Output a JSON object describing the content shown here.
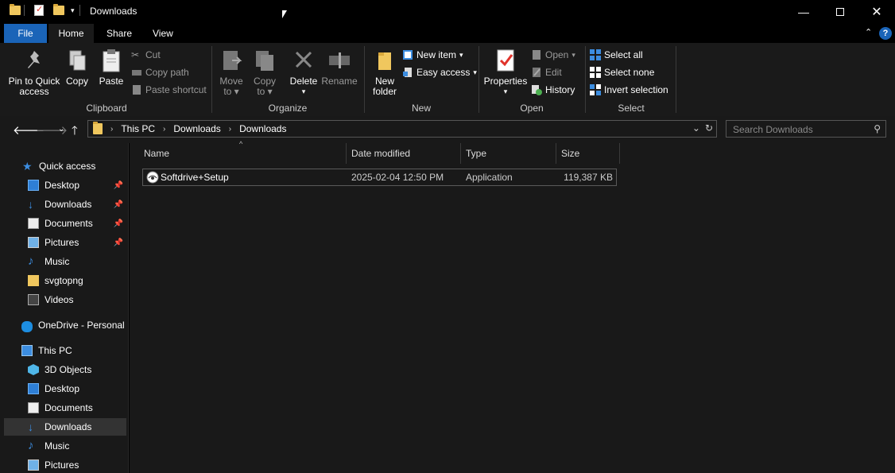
{
  "window": {
    "title": "Downloads",
    "controls": {
      "minimize": "—",
      "maximize": "",
      "close": "✕"
    }
  },
  "ribbon_tabs": [
    {
      "label": "File"
    },
    {
      "label": "Home"
    },
    {
      "label": "Share"
    },
    {
      "label": "View"
    }
  ],
  "ribbon": {
    "clipboard": {
      "label": "Clipboard",
      "pin_line1": "Pin to Quick",
      "pin_line2": "access",
      "copy": "Copy",
      "paste": "Paste",
      "cut": "Cut",
      "copy_path": "Copy path",
      "paste_shortcut": "Paste shortcut"
    },
    "organize": {
      "label": "Organize",
      "move_line1": "Move",
      "move_line2": "to",
      "copy_line1": "Copy",
      "copy_line2": "to",
      "delete": "Delete",
      "rename": "Rename"
    },
    "new": {
      "label": "New",
      "folder_line1": "New",
      "folder_line2": "folder",
      "new_item": "New item",
      "easy_access": "Easy access"
    },
    "open": {
      "label": "Open",
      "properties": "Properties",
      "open": "Open",
      "edit": "Edit",
      "history": "History"
    },
    "select": {
      "label": "Select",
      "select_all": "Select all",
      "select_none": "Select none",
      "invert": "Invert selection"
    }
  },
  "address": {
    "crumbs": [
      "This PC",
      "Downloads",
      "Downloads"
    ],
    "search_placeholder": "Search Downloads"
  },
  "nav": {
    "quick_access": "Quick access",
    "quick_items": [
      {
        "label": "Desktop",
        "pinned": true
      },
      {
        "label": "Downloads",
        "pinned": true
      },
      {
        "label": "Documents",
        "pinned": true
      },
      {
        "label": "Pictures",
        "pinned": true
      },
      {
        "label": "Music",
        "pinned": false
      },
      {
        "label": "svgtopng",
        "pinned": false
      },
      {
        "label": "Videos",
        "pinned": false
      }
    ],
    "onedrive": "OneDrive - Personal",
    "this_pc": "This PC",
    "pc_items": [
      {
        "label": "3D Objects"
      },
      {
        "label": "Desktop"
      },
      {
        "label": "Documents"
      },
      {
        "label": "Downloads",
        "selected": true
      },
      {
        "label": "Music"
      },
      {
        "label": "Pictures"
      }
    ]
  },
  "columns": [
    "Name",
    "Date modified",
    "Type",
    "Size"
  ],
  "files": [
    {
      "name": "Softdrive+Setup",
      "date": "2025-02-04 12:50 PM",
      "type": "Application",
      "size": "119,387 KB"
    }
  ],
  "colors": {
    "accent": "#1a64b8",
    "background": "#191919"
  }
}
